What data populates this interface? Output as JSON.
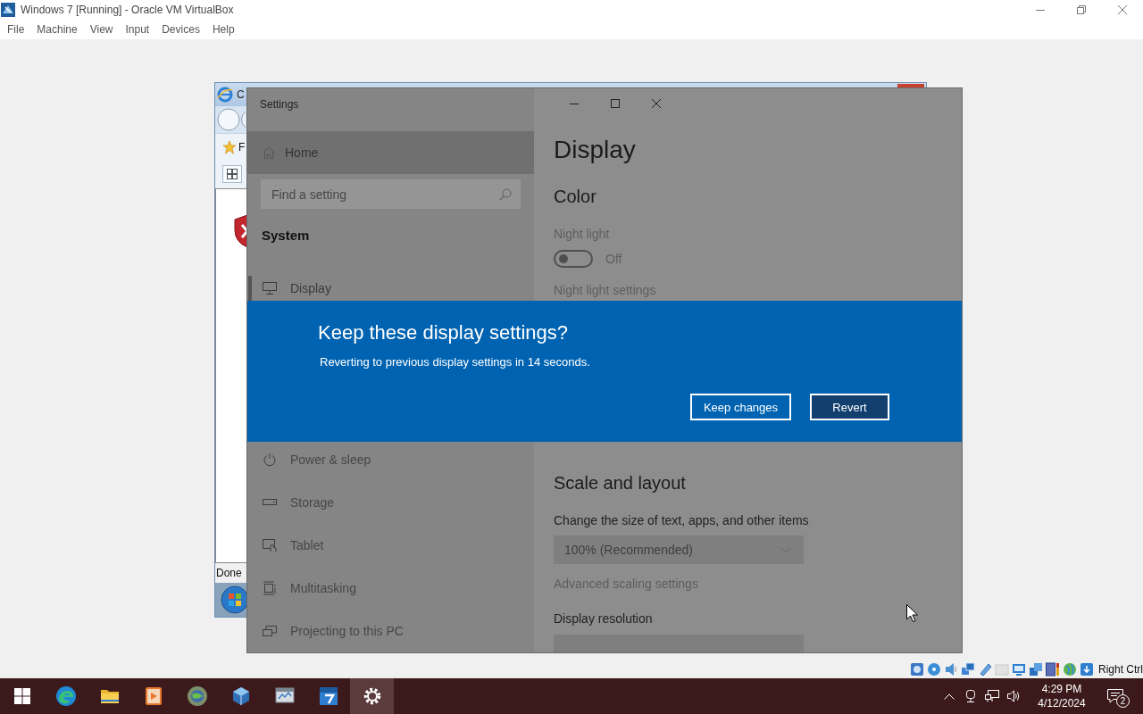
{
  "window": {
    "title": "Windows 7 [Running] - Oracle VM VirtualBox"
  },
  "menu": [
    "File",
    "Machine",
    "View",
    "Input",
    "Devices",
    "Help"
  ],
  "background_window": {
    "title": "C",
    "toolbar_text": "F",
    "status": "Done"
  },
  "settings": {
    "title": "Settings",
    "home": "Home",
    "search": {
      "placeholder": "Find a setting"
    },
    "section": "System",
    "nav": [
      {
        "label": "Display",
        "selected": true
      },
      {
        "label": "Power & sleep",
        "selected": false
      },
      {
        "label": "Storage",
        "selected": false
      },
      {
        "label": "Tablet",
        "selected": false
      },
      {
        "label": "Multitasking",
        "selected": false
      },
      {
        "label": "Projecting to this PC",
        "selected": false
      }
    ],
    "page_title": "Display",
    "color": {
      "heading": "Color",
      "night_light": {
        "label": "Night light",
        "on": false,
        "state": "Off",
        "link": "Night light settings"
      }
    },
    "scale": {
      "heading": "Scale and layout",
      "size_label": "Change the size of text, apps, and other items",
      "size_value": "100% (Recommended)",
      "advanced_link": "Advanced scaling settings",
      "resolution_label": "Display resolution"
    }
  },
  "dialog": {
    "title": "Keep these display settings?",
    "message": "Reverting to previous display settings in 14 seconds.",
    "buttons": [
      {
        "label": "Keep changes",
        "focused": false
      },
      {
        "label": "Revert",
        "focused": true
      }
    ]
  },
  "status_bar": {
    "host_key": "Right Ctrl"
  },
  "taskbar": {
    "apps": [
      {
        "selected": false
      },
      {
        "selected": false
      },
      {
        "selected": false
      },
      {
        "selected": false
      },
      {
        "selected": false
      },
      {
        "selected": false
      },
      {
        "selected": false
      },
      {
        "selected": true
      }
    ],
    "time": "4:29 PM",
    "date": "4/12/2024",
    "notifications": "2"
  }
}
